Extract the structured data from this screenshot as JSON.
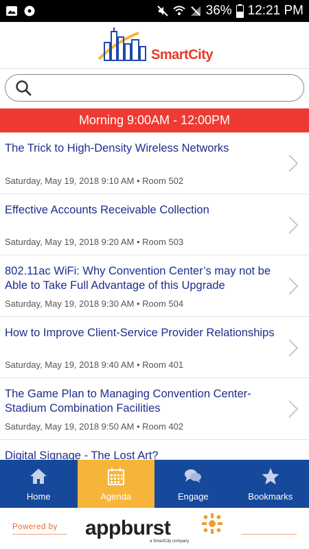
{
  "status_bar": {
    "battery": "36%",
    "time": "12:21 PM"
  },
  "logo": {
    "name_part1": "Smart",
    "name_part2": "City"
  },
  "search": {
    "placeholder": ""
  },
  "section": {
    "title": "Morning 9:00AM - 12:00PM"
  },
  "sessions": [
    {
      "title": "The Trick to High-Density Wireless Networks",
      "meta": "Saturday, May 19, 2018 9:10 AM • Room 502"
    },
    {
      "title": "Effective Accounts Receivable Collection",
      "meta": "Saturday, May 19, 2018 9:20 AM • Room 503"
    },
    {
      "title": "802.11ac WiFi: Why Convention Center’s may not be Able to Take Full Advantage of this Upgrade",
      "meta": "Saturday, May 19, 2018 9:30 AM • Room 504"
    },
    {
      "title": "How to Improve Client-Service Provider Relationships",
      "meta": "Saturday, May 19, 2018 9:40 AM • Room 401"
    },
    {
      "title": "The Game Plan to Managing Convention Center-Stadium Combination Facilities",
      "meta": "Saturday, May 19, 2018 9:50 AM • Room 402"
    },
    {
      "title": "Digital Signage - The Lost Art?",
      "meta": ""
    }
  ],
  "tabs": [
    {
      "label": "Home",
      "icon": "home-icon"
    },
    {
      "label": "Agenda",
      "icon": "calendar-icon"
    },
    {
      "label": "Engage",
      "icon": "chat-icon"
    },
    {
      "label": "Bookmarks",
      "icon": "star-icon"
    }
  ],
  "footer": {
    "powered_by": "Powered by",
    "brand": "appburst",
    "sub": "a SmartCity company"
  },
  "colors": {
    "section_red": "#ef3a33",
    "tab_blue": "#16489b",
    "tab_active": "#f6b53a",
    "title_blue": "#1d2d8c"
  }
}
